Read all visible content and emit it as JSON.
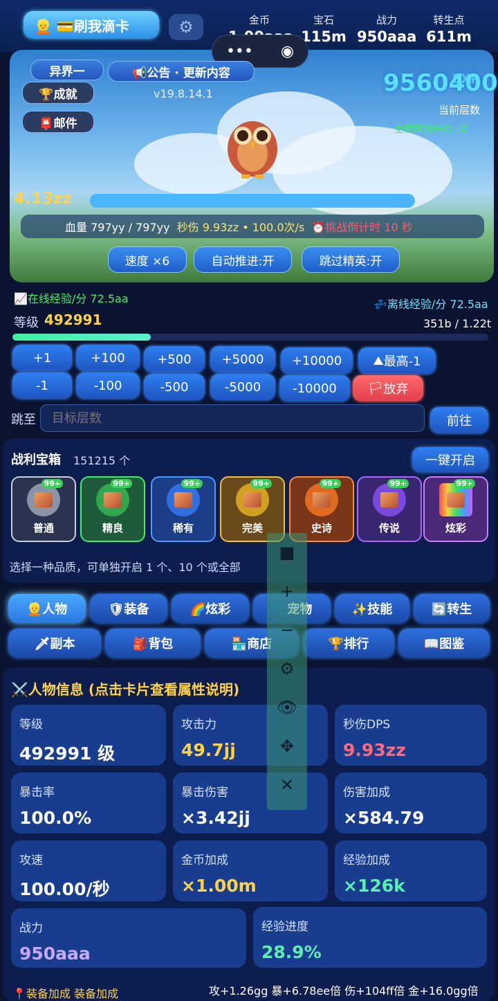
{
  "top": {
    "card_button": "👱 💳刷我滴卡",
    "gold_label": "金币",
    "gold_value": "1.00aaa",
    "gem_label": "宝石",
    "gem_value": "115m",
    "power_label": "战力",
    "power_value": "950aaa",
    "rebirth_label": "转生点",
    "rebirth_value": "611m",
    "mini_dots": "•••"
  },
  "scene": {
    "world": "异界一",
    "notice": "📢公告 · 更新内容",
    "version": "v19.8.14.1",
    "achieve": "🏆成就",
    "mail": "📮邮件",
    "big_score": "9560400",
    "layer_label": "当前层数",
    "offline_elite": "全额离线经验: 是",
    "exp_tag": "EXP",
    "damage_float": "4.13zz",
    "hp_text": "血量 797yy / 797yy",
    "dps_text": "秒伤 9.93zz • 100.0次/s",
    "countdown": "⏰挑战倒计时 10 秒",
    "speed_btn": "速度 ×6",
    "auto_btn": "自动推进:开",
    "skip_btn": "跳过精英:开",
    "hp_fill": 0.95
  },
  "exp": {
    "online": "在线经验/分 72.5aa",
    "offline": "离线经验/分 72.5aa",
    "level_label": "等级",
    "level_value": "492991",
    "progress_text": "351b / 1.22t",
    "progress": 0.29
  },
  "level_buttons": {
    "row1": [
      "+1",
      "+100",
      "+500",
      "+5000",
      "+10000",
      "最高-1"
    ],
    "row2": [
      "-1",
      "-100",
      "-500",
      "-5000",
      "-10000",
      "放弃"
    ]
  },
  "jump": {
    "label": "跳至",
    "placeholder": "目标层数",
    "go": "前往"
  },
  "chests": {
    "title": "战利宝箱",
    "count": "151215 个",
    "open_all": "一键开启",
    "badge": "99+",
    "items": [
      "普通",
      "精良",
      "稀有",
      "完美",
      "史诗",
      "传说",
      "炫彩"
    ],
    "hint": "选择一种品质，可单独开启 1 个、10 个或全部"
  },
  "tabs": {
    "row1": [
      "👱人物",
      "🛡装备",
      "🌈炫彩",
      "🐾宠物",
      "✨技能",
      "🔄转生"
    ],
    "row2": [
      "🗡副本",
      "🎒背包",
      "🏪商店",
      "🏆排行",
      "📖图鉴"
    ]
  },
  "char": {
    "title": "⚔️人物信息 (点击卡片查看属性说明)",
    "cards": [
      {
        "label": "等级",
        "value": "492991 级",
        "color": "#ffffff"
      },
      {
        "label": "攻击力",
        "value": "49.7jj",
        "color": "#ffd24a"
      },
      {
        "label": "秒伤DPS",
        "value": "9.93zz",
        "color": "#ff6a7a"
      },
      {
        "label": "暴击率",
        "value": "100.0%",
        "color": "#ffffff"
      },
      {
        "label": "暴击伤害",
        "value": "×3.42jj",
        "color": "#ffffff"
      },
      {
        "label": "伤害加成",
        "value": "×584.79",
        "color": "#ffffff"
      },
      {
        "label": "攻速",
        "value": "100.00/秒",
        "color": "#ffffff"
      },
      {
        "label": "金币加成",
        "value": "×1.00m",
        "color": "#ffd24a"
      },
      {
        "label": "经验加成",
        "value": "×126k",
        "color": "#5cf0b0"
      },
      {
        "label": "战力",
        "value": "950aaa",
        "color": "#c9a8ff"
      },
      {
        "label": "经验进度",
        "value": "28.9%",
        "color": "#5cf0b0"
      }
    ]
  },
  "footer": {
    "left": "装备加成 装备加成",
    "right": "攻+1.26gg 暴+6.78ee倍 伤+104ff倍 金+16.0gg倍"
  },
  "tool_icons": [
    "square-icon",
    "plus-icon",
    "minus-icon",
    "gear-icon",
    "eye-icon",
    "move-icon",
    "close-icon"
  ],
  "tool_glyphs": [
    "■",
    "+",
    "−",
    "⚙",
    "👁",
    "✥",
    "✕"
  ]
}
